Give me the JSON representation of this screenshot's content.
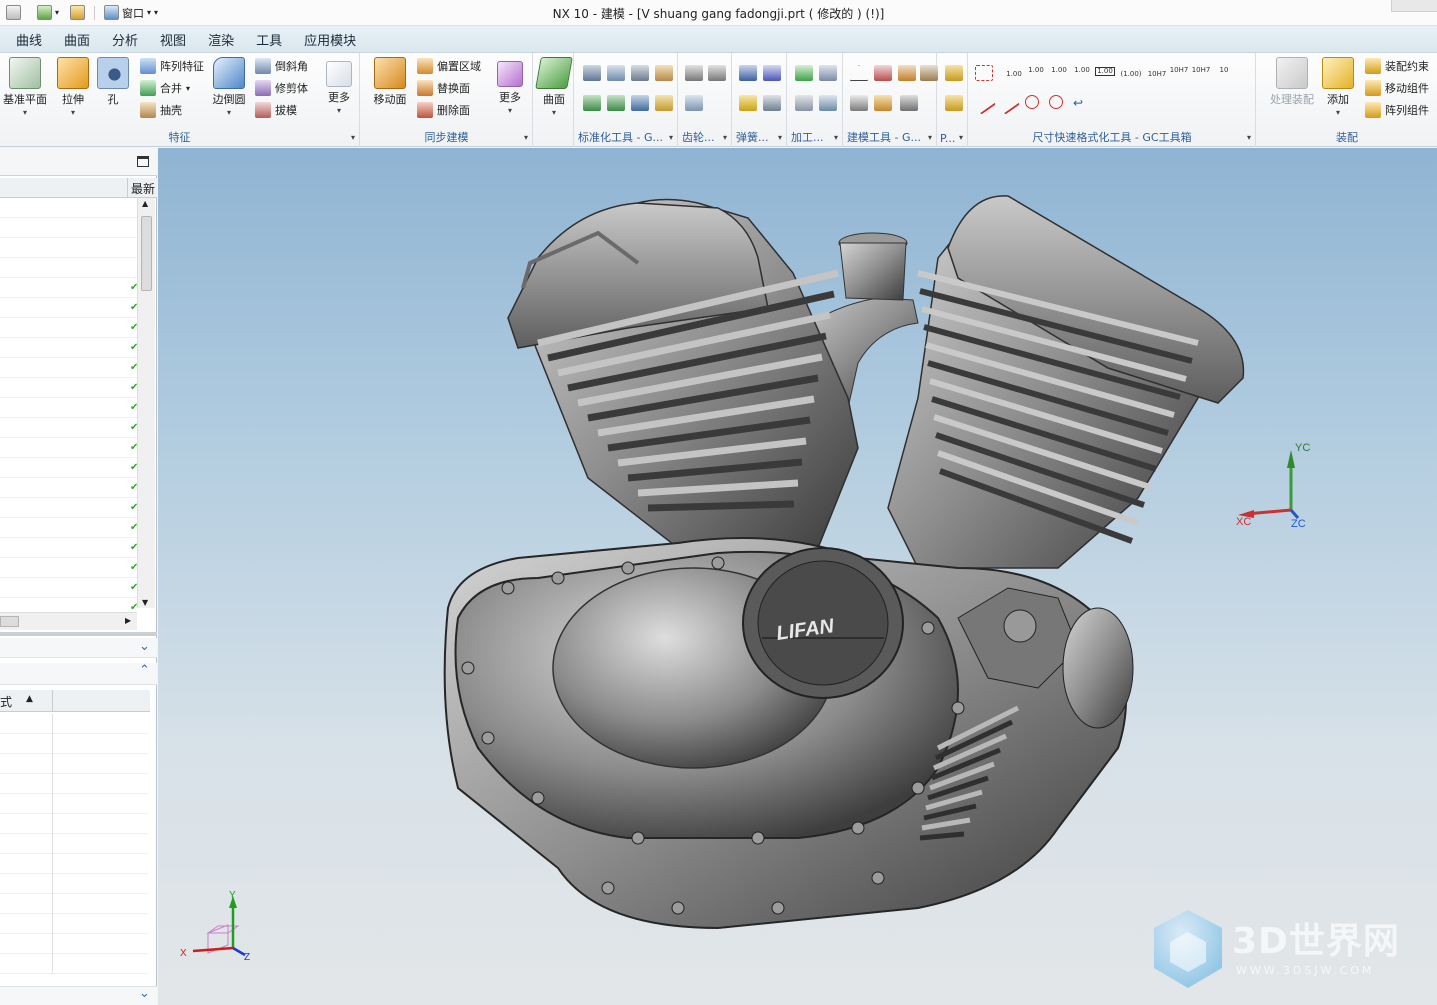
{
  "title": {
    "app": "NX 10 - 建模 - [V shuang gang fadongji.prt  ( 修改的 )      (!)]",
    "window_menu": "窗口"
  },
  "menubar": [
    "曲线",
    "曲面",
    "分析",
    "视图",
    "渲染",
    "工具",
    "应用模块"
  ],
  "ribbon": {
    "feature": {
      "label": "特征",
      "datum_plane": "基准平面",
      "extrude": "拉伸",
      "hole": "孔",
      "pattern_feature": "阵列特征",
      "unite": "合并",
      "shell": "抽壳",
      "edge_blend": "边倒圆",
      "chamfer": "倒斜角",
      "trim_body": "修剪体",
      "draft": "拔模",
      "more": "更多"
    },
    "sync": {
      "label": "同步建模",
      "move_face": "移动面",
      "offset_region": "偏置区域",
      "replace_face": "替换面",
      "delete_face": "删除面",
      "more": "更多"
    },
    "surface": {
      "label": "曲面"
    },
    "gc_tools": [
      "标准化工具 - G...",
      "齿轮...",
      "弹簧...",
      "加工...",
      "建模工具 - G...",
      "P..."
    ],
    "dim_tools": {
      "label": "尺寸快速格式化工具 - GC工具箱",
      "values": [
        "1.00",
        "1.00",
        "1.00",
        "1.00",
        "1.00",
        "(1.00)",
        "10H7",
        "10H7",
        "10H7",
        "10"
      ]
    },
    "assembly": {
      "label": "装配",
      "process_assembly": "处理装配",
      "add": "添加",
      "assembly_constraint": "装配约束",
      "move_component": "移动组件",
      "pattern_component": "阵列组件"
    }
  },
  "left_panel": {
    "column_latest": "最新",
    "column_mode_fragment": "式"
  },
  "viewport": {
    "logo": "LIFAN",
    "triad": {
      "yc": "YC",
      "xc": "XC",
      "zc": "ZC"
    },
    "corner_triad": {
      "x": "X",
      "y": "Y",
      "z": "Z"
    },
    "watermark_title": "3D世界网",
    "watermark_url": "WWW.3DSJW.COM"
  }
}
